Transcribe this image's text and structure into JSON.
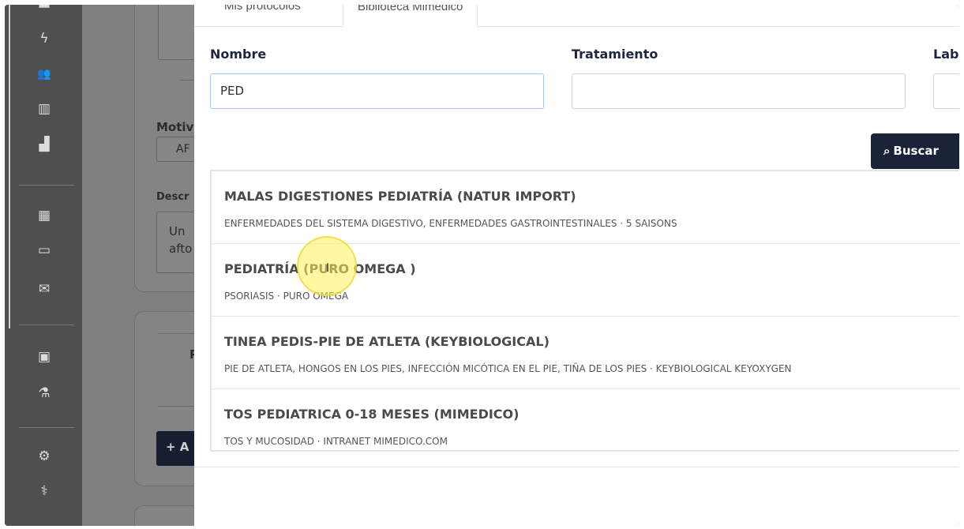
{
  "sidebar": {
    "icons": [
      {
        "name": "bolt-icon",
        "glyph": "ϟ"
      },
      {
        "name": "users-icon",
        "glyph": "👥"
      },
      {
        "name": "barcode-icon",
        "glyph": "▥"
      },
      {
        "name": "bar-chart-icon",
        "glyph": "▟"
      },
      {
        "name": "calendar-icon",
        "glyph": "▦"
      },
      {
        "name": "credit-card-icon",
        "glyph": "▭"
      },
      {
        "name": "envelope-icon",
        "glyph": "✉"
      },
      {
        "name": "id-card-icon",
        "glyph": "▣"
      },
      {
        "name": "flask-icon",
        "glyph": "⚗"
      },
      {
        "name": "cogs-icon",
        "glyph": "⚙"
      },
      {
        "name": "doctor-icon",
        "glyph": "⚕"
      }
    ]
  },
  "background": {
    "motivo_label": "Motiv",
    "motivo_value": "AF",
    "descr_label": "Descr",
    "descr_text_1": "Un",
    "descr_text_2": "afto",
    "partial_letter": "P",
    "add_button": "+ A"
  },
  "modal": {
    "tabs": [
      {
        "label": "Mis protocolos",
        "active": false
      },
      {
        "label": "Biblioteca Mimedico",
        "active": true
      }
    ],
    "fields": {
      "nombre_label": "Nombre",
      "nombre_value": "PED",
      "tratamiento_label": "Tratamiento",
      "tratamiento_value": "",
      "lab_label": "Lab",
      "lab_value": ""
    },
    "search_button": "Buscar",
    "results": [
      {
        "title": "MALAS DIGESTIONES PEDIATRÍA (NATUR IMPORT)",
        "subtitle": "ENFERMEDADES DEL SISTEMA DIGESTIVO, ENFERMEDADES GASTROINTESTINALES · 5 SAISONS"
      },
      {
        "title": "PEDIATRÍA (PURO OMEGA )",
        "subtitle": "PSORIASIS · PURO OMEGA"
      },
      {
        "title": "TINEA PEDIS-PIE DE ATLETA (KEYBIOLOGICAL)",
        "subtitle": "PIE DE ATLETA, HONGOS EN LOS PIES, INFECCIÓN MICÓTICA EN EL PIE, TIÑA DE LOS PIES · KEYBIOLOGICAL KEYOXYGEN"
      },
      {
        "title": "TOS PEDIATRICA 0-18 MESES (MIMEDICO)",
        "subtitle": "TOS Y MUCOSIDAD · INTRANET MIMEDICO.COM"
      }
    ]
  },
  "colors": {
    "brand_dark": "#1a2238",
    "sidebar": "#4f4f4f",
    "overlay": "#7f7f7f",
    "cursor_highlight": "#fff05a"
  }
}
